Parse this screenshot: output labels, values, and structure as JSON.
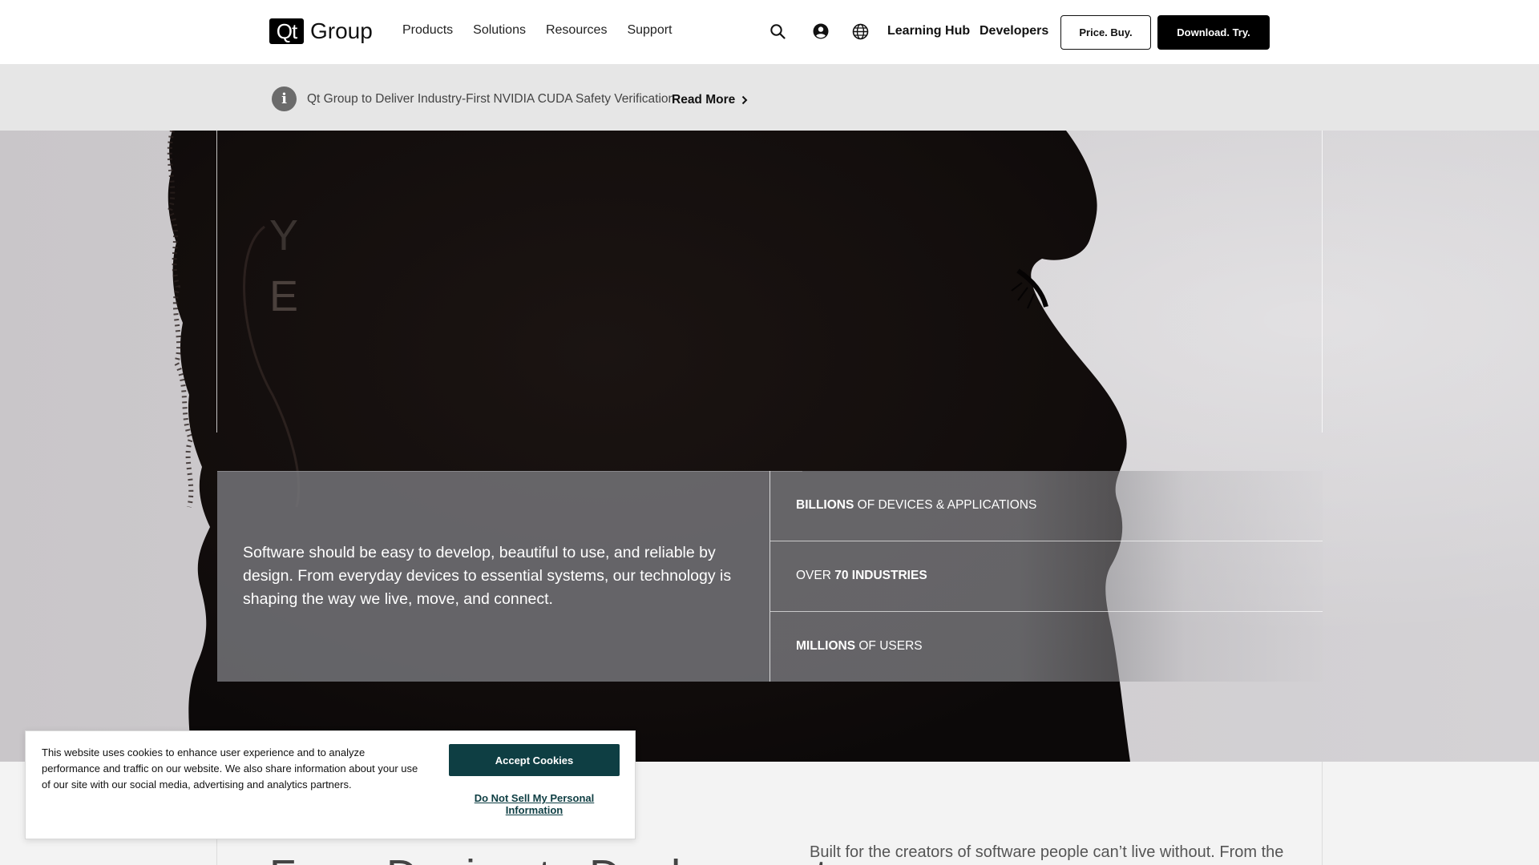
{
  "header": {
    "logo_box": "Qt",
    "logo_text": "Group",
    "nav": [
      "Products",
      "Solutions",
      "Resources",
      "Support"
    ],
    "learning_hub": "Learning Hub",
    "developers": "Developers",
    "price_buy": "Price. Buy.",
    "download_try": "Download. Try.",
    "icons": [
      "search-icon",
      "account-icon",
      "globe-icon"
    ]
  },
  "announcement": {
    "icon": "i",
    "text": "Qt Group to Deliver Industry-First NVIDIA CUDA Safety Verification",
    "link": "Read More"
  },
  "hero": {
    "heading_fragment_1": "Y",
    "heading_fragment_2": "E",
    "description": "Software should be easy to develop, beautiful to use, and reliable by design. From everyday devices to essential systems, our technology is shaping the way we live, move, and connect.",
    "stats": [
      {
        "strong": "BILLIONS",
        "rest": " OF DEVICES & APPLICATIONS"
      },
      {
        "prefix": "OVER ",
        "strong": "70 INDUSTRIES"
      },
      {
        "strong": "MILLIONS",
        "rest": " OF USERS"
      }
    ]
  },
  "below": {
    "heading_partial": "From Design to Deployment",
    "text": "Built for the creators of software people can’t live without. From the"
  },
  "cookie": {
    "text": "This website uses cookies to enhance user experience and to analyze performance and traffic on our website. We also share information about your use of our site with our social media, advertising and analytics partners.",
    "accept": "Accept Cookies",
    "do_not_sell": "Do Not Sell My Personal Information"
  },
  "colors": {
    "primary_dark": "#000000",
    "cookie_button": "#0e3e43",
    "announce_bg": "#e6e6e6"
  }
}
